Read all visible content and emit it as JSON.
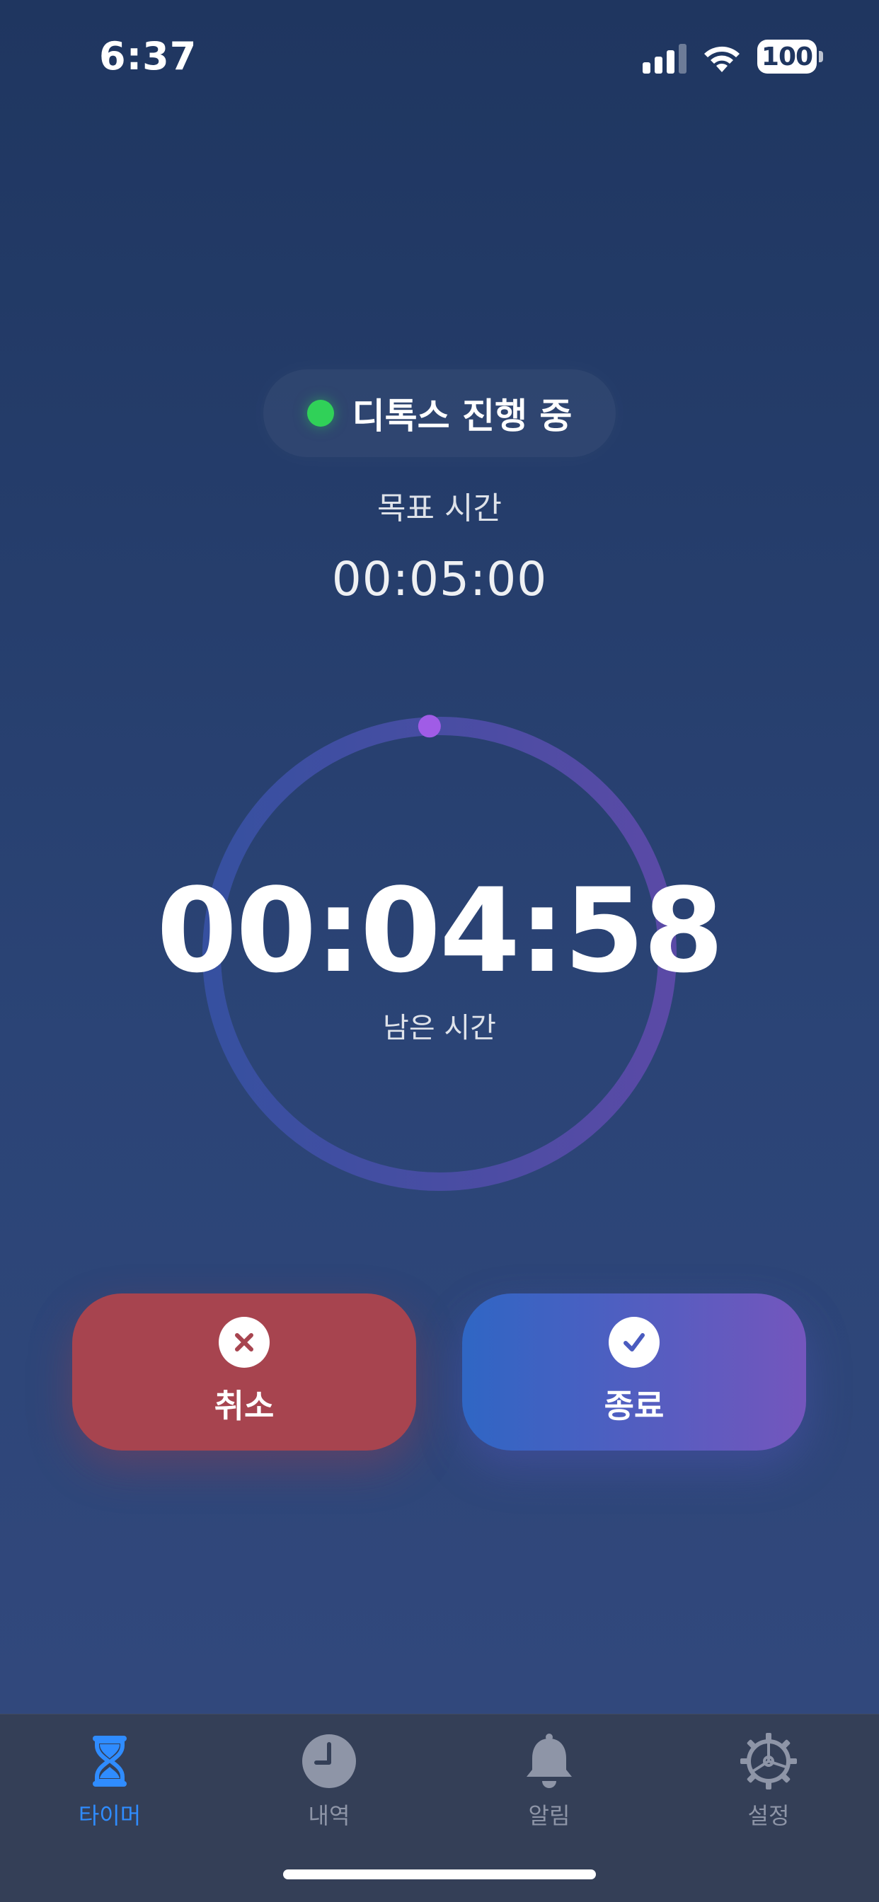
{
  "status_bar": {
    "time": "6:37",
    "battery": "100"
  },
  "session": {
    "status_text": "디톡스 진행 중",
    "status_color": "#30d158",
    "goal_label": "목표 시간",
    "goal_time": "00:05:00",
    "remaining_time": "00:04:58",
    "remaining_label": "남은 시간",
    "progress_remaining_fraction": 0.993
  },
  "actions": {
    "cancel_label": "취소",
    "finish_label": "종료",
    "cancel_color": "#a7444f"
  },
  "tabs": [
    {
      "label": "타이머",
      "icon": "hourglass-icon",
      "active": true
    },
    {
      "label": "내역",
      "icon": "clock-icon",
      "active": false
    },
    {
      "label": "알림",
      "icon": "bell-icon",
      "active": false
    },
    {
      "label": "설정",
      "icon": "gear-icon",
      "active": false
    }
  ],
  "colors": {
    "accent": "#2f8cff",
    "ring_start": "#3650a0",
    "ring_end": "#5a4aa6",
    "ring_knob": "#a05ce6"
  }
}
